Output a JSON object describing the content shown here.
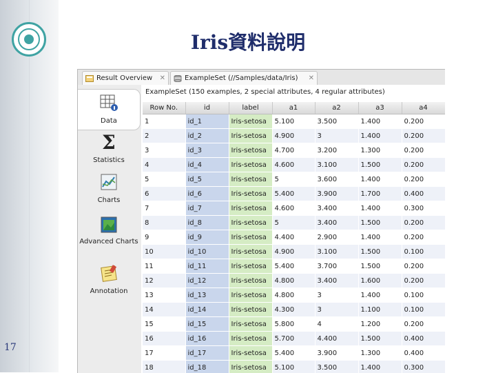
{
  "slide": {
    "title": "Iris資料說明",
    "page_number": "17"
  },
  "tabs": [
    {
      "label": "Result Overview",
      "icon": "result-overview-icon"
    },
    {
      "label": "ExampleSet (//Samples/data/Iris)",
      "icon": "database-icon"
    }
  ],
  "views": [
    {
      "label": "Data",
      "icon": "data-table-icon",
      "active": true
    },
    {
      "label": "Statistics",
      "icon": "sigma-icon",
      "active": false
    },
    {
      "label": "Charts",
      "icon": "chart-icon",
      "active": false
    },
    {
      "label": "Advanced Charts",
      "icon": "advanced-chart-icon",
      "active": false
    },
    {
      "label": "Annotation",
      "icon": "note-icon",
      "active": false
    }
  ],
  "summary": "ExampleSet (150 examples, 2 special attributes, 4 regular attributes)",
  "table": {
    "columns": [
      "Row No.",
      "id",
      "label",
      "a1",
      "a2",
      "a3",
      "a4"
    ],
    "rows": [
      [
        "1",
        "id_1",
        "Iris-setosa",
        "5.100",
        "3.500",
        "1.400",
        "0.200"
      ],
      [
        "2",
        "id_2",
        "Iris-setosa",
        "4.900",
        "3",
        "1.400",
        "0.200"
      ],
      [
        "3",
        "id_3",
        "Iris-setosa",
        "4.700",
        "3.200",
        "1.300",
        "0.200"
      ],
      [
        "4",
        "id_4",
        "Iris-setosa",
        "4.600",
        "3.100",
        "1.500",
        "0.200"
      ],
      [
        "5",
        "id_5",
        "Iris-setosa",
        "5",
        "3.600",
        "1.400",
        "0.200"
      ],
      [
        "6",
        "id_6",
        "Iris-setosa",
        "5.400",
        "3.900",
        "1.700",
        "0.400"
      ],
      [
        "7",
        "id_7",
        "Iris-setosa",
        "4.600",
        "3.400",
        "1.400",
        "0.300"
      ],
      [
        "8",
        "id_8",
        "Iris-setosa",
        "5",
        "3.400",
        "1.500",
        "0.200"
      ],
      [
        "9",
        "id_9",
        "Iris-setosa",
        "4.400",
        "2.900",
        "1.400",
        "0.200"
      ],
      [
        "10",
        "id_10",
        "Iris-setosa",
        "4.900",
        "3.100",
        "1.500",
        "0.100"
      ],
      [
        "11",
        "id_11",
        "Iris-setosa",
        "5.400",
        "3.700",
        "1.500",
        "0.200"
      ],
      [
        "12",
        "id_12",
        "Iris-setosa",
        "4.800",
        "3.400",
        "1.600",
        "0.200"
      ],
      [
        "13",
        "id_13",
        "Iris-setosa",
        "4.800",
        "3",
        "1.400",
        "0.100"
      ],
      [
        "14",
        "id_14",
        "Iris-setosa",
        "4.300",
        "3",
        "1.100",
        "0.100"
      ],
      [
        "15",
        "id_15",
        "Iris-setosa",
        "5.800",
        "4",
        "1.200",
        "0.200"
      ],
      [
        "16",
        "id_16",
        "Iris-setosa",
        "5.700",
        "4.400",
        "1.500",
        "0.400"
      ],
      [
        "17",
        "id_17",
        "Iris-setosa",
        "5.400",
        "3.900",
        "1.300",
        "0.400"
      ],
      [
        "18",
        "id_18",
        "Iris-setosa",
        "5.100",
        "3.500",
        "1.400",
        "0.300"
      ]
    ]
  },
  "colors": {
    "id_column": "#c9d6ec",
    "label_column": "#d5ecc4",
    "title": "#1f2d6b"
  }
}
